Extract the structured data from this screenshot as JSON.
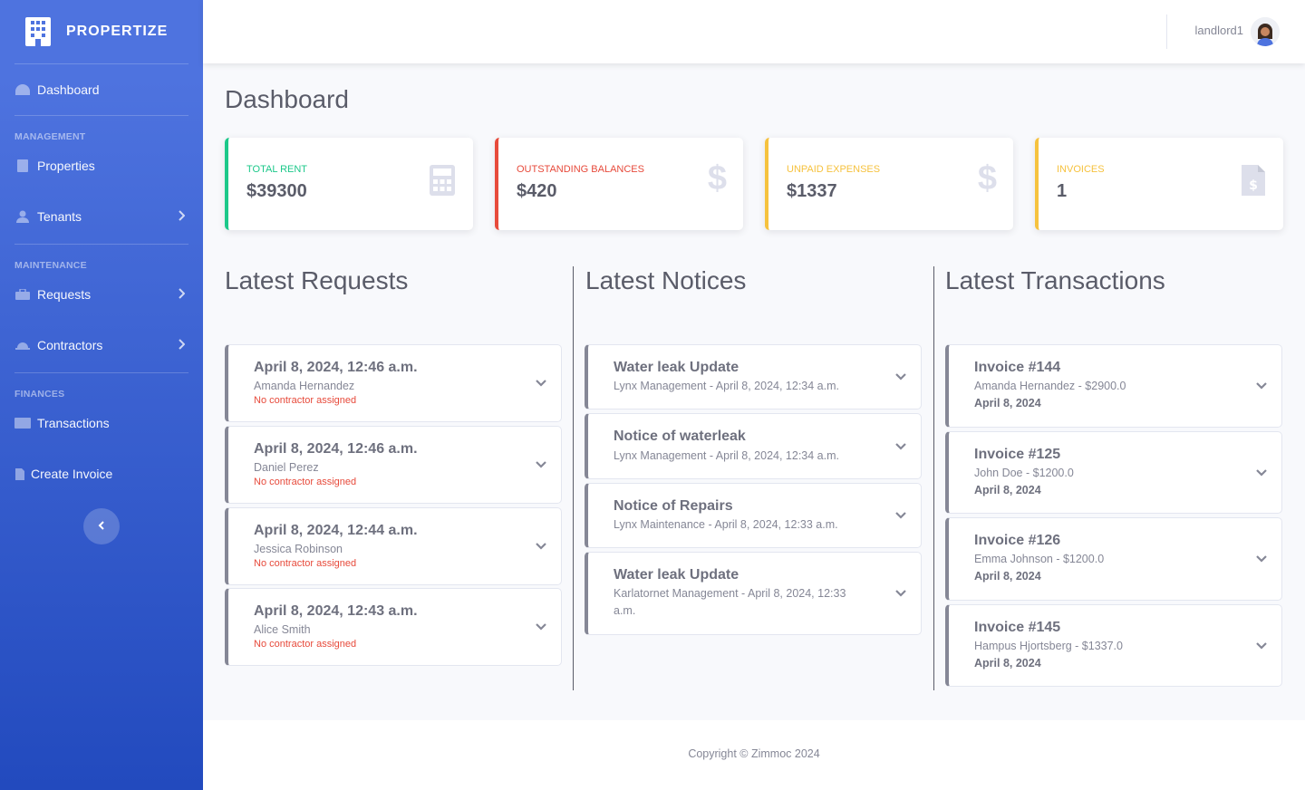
{
  "brand": {
    "name": "PROPERTIZE"
  },
  "sidebar": {
    "dashboard": "Dashboard",
    "management_heading": "MANAGEMENT",
    "properties": "Properties",
    "tenants": "Tenants",
    "maintenance_heading": "MAINTENANCE",
    "requests": "Requests",
    "contractors": "Contractors",
    "finances_heading": "FINANCES",
    "transactions": "Transactions",
    "create_invoice": "Create Invoice"
  },
  "topbar": {
    "username": "landlord1"
  },
  "page": {
    "title": "Dashboard"
  },
  "stats": [
    {
      "label": "TOTAL RENT",
      "value": "$39300",
      "color": "#1cc88a",
      "icon": "calculator-icon"
    },
    {
      "label": "OUTSTANDING BALANCES",
      "value": "$420",
      "color": "#e74a3b",
      "icon": "dollar-icon"
    },
    {
      "label": "UNPAID EXPENSES",
      "value": "$1337",
      "color": "#f6c23e",
      "icon": "dollar-icon"
    },
    {
      "label": "INVOICES",
      "value": "1",
      "color": "#f6c23e",
      "icon": "invoice-file-icon"
    }
  ],
  "requests": {
    "title": "Latest Requests",
    "items": [
      {
        "date": "April 8, 2024, 12:46 a.m.",
        "tenant": "Amanda Hernandez",
        "status": "No contractor assigned"
      },
      {
        "date": "April 8, 2024, 12:46 a.m.",
        "tenant": "Daniel Perez",
        "status": "No contractor assigned"
      },
      {
        "date": "April 8, 2024, 12:44 a.m.",
        "tenant": "Jessica Robinson",
        "status": "No contractor assigned"
      },
      {
        "date": "April 8, 2024, 12:43 a.m.",
        "tenant": "Alice Smith",
        "status": "No contractor assigned"
      }
    ]
  },
  "notices": {
    "title": "Latest Notices",
    "items": [
      {
        "title": "Water leak Update",
        "meta": "Lynx Management - April 8, 2024, 12:34 a.m."
      },
      {
        "title": "Notice of waterleak",
        "meta": "Lynx Management - April 8, 2024, 12:34 a.m."
      },
      {
        "title": "Notice of Repairs",
        "meta": "Lynx Maintenance - April 8, 2024, 12:33 a.m."
      },
      {
        "title": "Water leak Update",
        "meta_line1": "Karlatornet Management - April 8, 2024, 12:33",
        "meta_line2": "a.m."
      }
    ]
  },
  "transactions": {
    "title": "Latest Transactions",
    "items": [
      {
        "invoice": "Invoice #144",
        "detail": "Amanda Hernandez - $2900.0",
        "date": "April 8, 2024"
      },
      {
        "invoice": "Invoice #125",
        "detail": "John Doe - $1200.0",
        "date": "April 8, 2024"
      },
      {
        "invoice": "Invoice #126",
        "detail": "Emma Johnson - $1200.0",
        "date": "April 8, 2024"
      },
      {
        "invoice": "Invoice #145",
        "detail": "Hampus Hjortsberg - $1337.0",
        "date": "April 8, 2024"
      }
    ]
  },
  "footer": {
    "copyright": "Copyright © Zimmoc 2024"
  }
}
